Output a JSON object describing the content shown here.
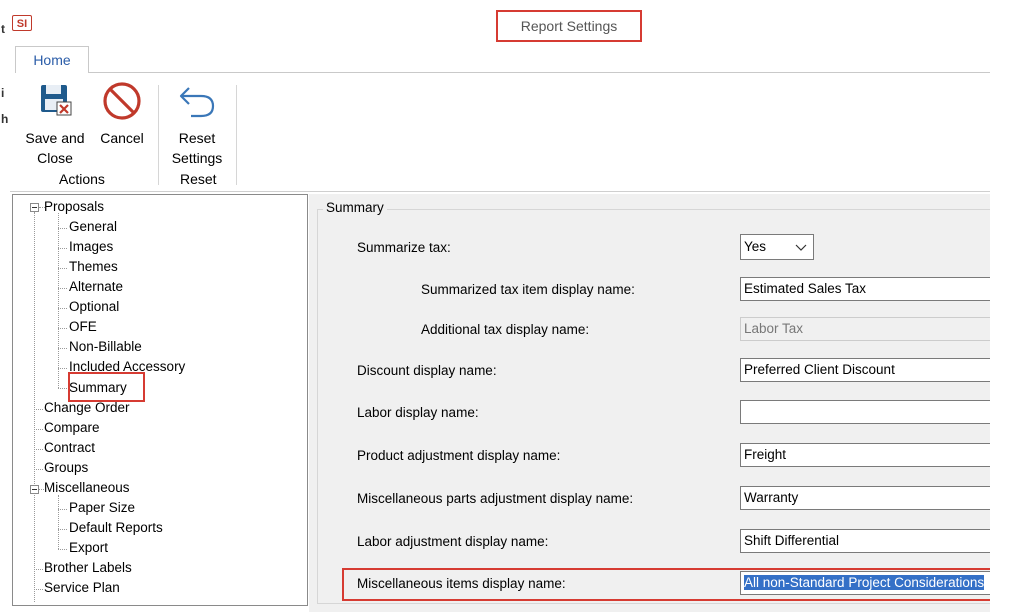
{
  "window": {
    "app_icon": "SI",
    "title": "Report Settings"
  },
  "ribbon": {
    "tab": "Home",
    "buttons": [
      {
        "id": "save-and-close",
        "label_line1": "Save and",
        "label_line2": "Close",
        "icon": "save-icon"
      },
      {
        "id": "cancel",
        "label_line1": "Cancel",
        "label_line2": "",
        "icon": "cancel-icon"
      },
      {
        "id": "reset-settings",
        "label_line1": "Reset",
        "label_line2": "Settings",
        "icon": "undo-icon"
      }
    ],
    "groups": {
      "actions": "Actions",
      "reset": "Reset"
    }
  },
  "left_edge_chars": [
    "t",
    "i",
    "h"
  ],
  "tree": {
    "proposals": "Proposals",
    "proposals_children": [
      "General",
      "Images",
      "Themes",
      "Alternate",
      "Optional",
      "OFE",
      "Non-Billable",
      "Included Accessory",
      "Summary"
    ],
    "top_items_1": [
      "Change Order",
      "Compare",
      "Contract",
      "Groups"
    ],
    "miscellaneous": "Miscellaneous",
    "misc_children": [
      "Paper Size",
      "Default Reports",
      "Export"
    ],
    "top_items_2": [
      "Brother Labels",
      "Service Plan"
    ],
    "selected": "Summary"
  },
  "summary": {
    "group_title": "Summary",
    "fields": {
      "summarize_tax": {
        "label": "Summarize tax:",
        "value": "Yes"
      },
      "summarized_tax_item": {
        "label": "Summarized tax item display name:",
        "value": "Estimated Sales Tax"
      },
      "additional_tax": {
        "label": "Additional tax display name:",
        "value": "Labor Tax"
      },
      "discount": {
        "label": "Discount display name:",
        "value": "Preferred Client Discount"
      },
      "labor": {
        "label": "Labor display name:",
        "value": ""
      },
      "product_adjustment": {
        "label": "Product adjustment display name:",
        "value": "Freight"
      },
      "misc_parts_adjustment": {
        "label": "Miscellaneous parts adjustment display name:",
        "value": "Warranty"
      },
      "labor_adjustment": {
        "label": "Labor adjustment display name:",
        "value": "Shift Differential"
      },
      "misc_items": {
        "label": "Miscellaneous items display name:",
        "value": "All non-Standard Project Considerations"
      }
    }
  },
  "colors": {
    "highlight_red": "#d63b32",
    "selection_blue": "#3470c7",
    "panel_bg": "#f0f0f0",
    "tab_text": "#2a5ca8"
  }
}
